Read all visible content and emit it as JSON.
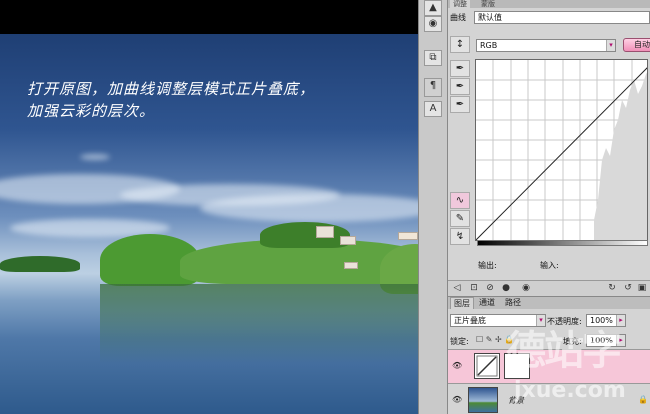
{
  "caption": {
    "line1": "打开原图，加曲线调整层模式正片叠底，",
    "line2": "加强云彩的层次。"
  },
  "adjustments": {
    "tab_adjust": "调整",
    "tab_mask": "蒙版",
    "preset_label": "曲线",
    "preset_value": "默认值",
    "channel_value": "RGB",
    "auto_label": "自动",
    "output_label": "输出:",
    "input_label": "输入:"
  },
  "layers": {
    "tabs": [
      "图层",
      "通道",
      "路径"
    ],
    "blend_mode": "正片叠底",
    "opacity_label": "不透明度:",
    "opacity_value": "100%",
    "lock_label": "锁定:",
    "fill_label": "填充:",
    "fill_value": "100%",
    "background_name": "背景"
  },
  "watermark": {
    "text": "德站字",
    "url": "jxue.com"
  },
  "colors": {
    "accent": "#f090b8",
    "highlight_row": "#f6c6d8"
  }
}
